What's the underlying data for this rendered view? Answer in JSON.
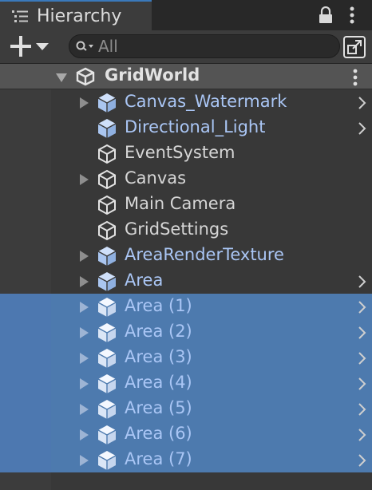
{
  "window": {
    "title": "Hierarchy",
    "tab_icon": "hierarchy-list-icon",
    "accent": "#3a79bb"
  },
  "toolbar": {
    "add_icon": "plus-icon",
    "search_placeholder": "All",
    "search_value": ""
  },
  "scene": {
    "name": "GridWorld",
    "icon": "unity-logo-icon",
    "expanded": true
  },
  "items": [
    {
      "label": "Canvas_Watermark",
      "prefab": true,
      "has_children": true,
      "has_override": true,
      "selected": false
    },
    {
      "label": "Directional_Light",
      "prefab": true,
      "has_children": false,
      "has_override": true,
      "selected": false
    },
    {
      "label": "EventSystem",
      "prefab": false,
      "has_children": false,
      "has_override": false,
      "selected": false
    },
    {
      "label": "Canvas",
      "prefab": false,
      "has_children": true,
      "has_override": false,
      "selected": false
    },
    {
      "label": "Main Camera",
      "prefab": false,
      "has_children": false,
      "has_override": false,
      "selected": false
    },
    {
      "label": "GridSettings",
      "prefab": false,
      "has_children": false,
      "has_override": false,
      "selected": false
    },
    {
      "label": "AreaRenderTexture",
      "prefab": true,
      "has_children": true,
      "has_override": false,
      "selected": false
    },
    {
      "label": "Area",
      "prefab": true,
      "has_children": true,
      "has_override": true,
      "selected": false
    },
    {
      "label": "Area (1)",
      "prefab": true,
      "has_children": true,
      "has_override": true,
      "selected": true
    },
    {
      "label": "Area (2)",
      "prefab": true,
      "has_children": true,
      "has_override": true,
      "selected": true
    },
    {
      "label": "Area (3)",
      "prefab": true,
      "has_children": true,
      "has_override": true,
      "selected": true
    },
    {
      "label": "Area (4)",
      "prefab": true,
      "has_children": true,
      "has_override": true,
      "selected": true
    },
    {
      "label": "Area (5)",
      "prefab": true,
      "has_children": true,
      "has_override": true,
      "selected": true
    },
    {
      "label": "Area (6)",
      "prefab": true,
      "has_children": true,
      "has_override": true,
      "selected": true
    },
    {
      "label": "Area (7)",
      "prefab": true,
      "has_children": true,
      "has_override": true,
      "selected": true
    }
  ],
  "colors": {
    "selection": "#4d7aae",
    "prefab_text": "#aac6f5",
    "scene_header": "#545454"
  }
}
